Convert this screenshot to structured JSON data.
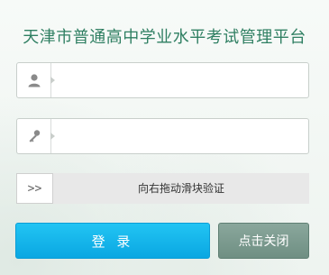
{
  "title": "天津市普通高中学业水平考试管理平台",
  "username": {
    "value": "",
    "placeholder": "",
    "icon": "user-icon"
  },
  "password": {
    "value": "",
    "placeholder": "",
    "icon": "key-icon"
  },
  "slider": {
    "handle_label": ">>",
    "hint": "向右拖动滑块验证"
  },
  "buttons": {
    "login": "登 录",
    "close": "点击关闭"
  },
  "colors": {
    "title": "#2f7f62",
    "login": "#14b6ec",
    "close": "#7a988c"
  }
}
